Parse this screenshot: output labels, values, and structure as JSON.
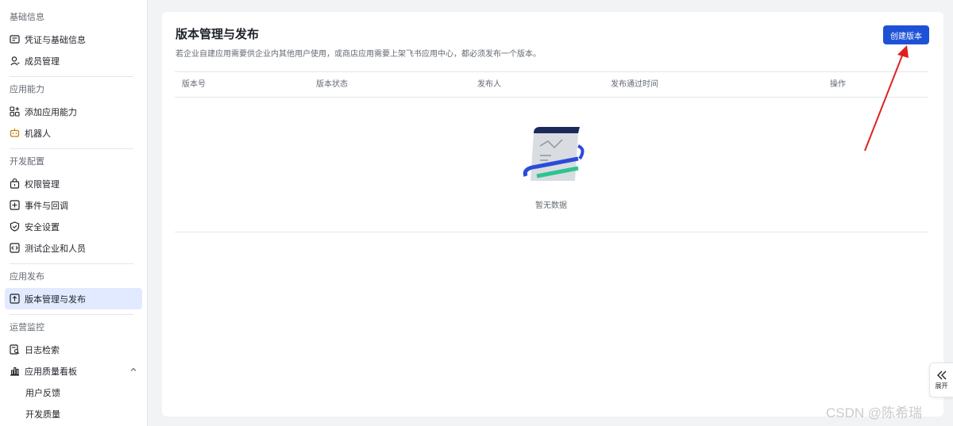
{
  "sidebar": {
    "groups": [
      {
        "title": "基础信息",
        "items": [
          {
            "label": "凭证与基础信息",
            "icon": "credential-icon"
          },
          {
            "label": "成员管理",
            "icon": "member-icon"
          }
        ]
      },
      {
        "title": "应用能力",
        "items": [
          {
            "label": "添加应用能力",
            "icon": "grid-add-icon"
          },
          {
            "label": "机器人",
            "icon": "robot-icon"
          }
        ]
      },
      {
        "title": "开发配置",
        "items": [
          {
            "label": "权限管理",
            "icon": "lock-icon"
          },
          {
            "label": "事件与回调",
            "icon": "event-icon"
          },
          {
            "label": "安全设置",
            "icon": "shield-icon"
          },
          {
            "label": "测试企业和人员",
            "icon": "code-icon"
          }
        ]
      },
      {
        "title": "应用发布",
        "items": [
          {
            "label": "版本管理与发布",
            "icon": "upload-icon",
            "active": true
          }
        ]
      },
      {
        "title": "运营监控",
        "items": [
          {
            "label": "日志检索",
            "icon": "log-search-icon"
          },
          {
            "label": "应用质量看板",
            "icon": "bar-chart-icon"
          },
          {
            "label": "用户反馈"
          },
          {
            "label": "开发质量"
          }
        ]
      }
    ]
  },
  "main": {
    "title": "版本管理与发布",
    "description": "若企业自建应用需要供企业内其他用户使用，或商店应用需要上架飞书应用中心，都必须发布一个版本。",
    "create_button": "创建版本",
    "table": {
      "columns": [
        "版本号",
        "版本状态",
        "发布人",
        "发布通过时间",
        "操作"
      ],
      "empty_text": "暂无数据"
    }
  },
  "expand": {
    "label": "展开"
  },
  "watermark": "CSDN @陈希瑞",
  "colors": {
    "primary": "#1e52d6",
    "active_bg": "#e1eaff",
    "annotation": "#e02020"
  }
}
